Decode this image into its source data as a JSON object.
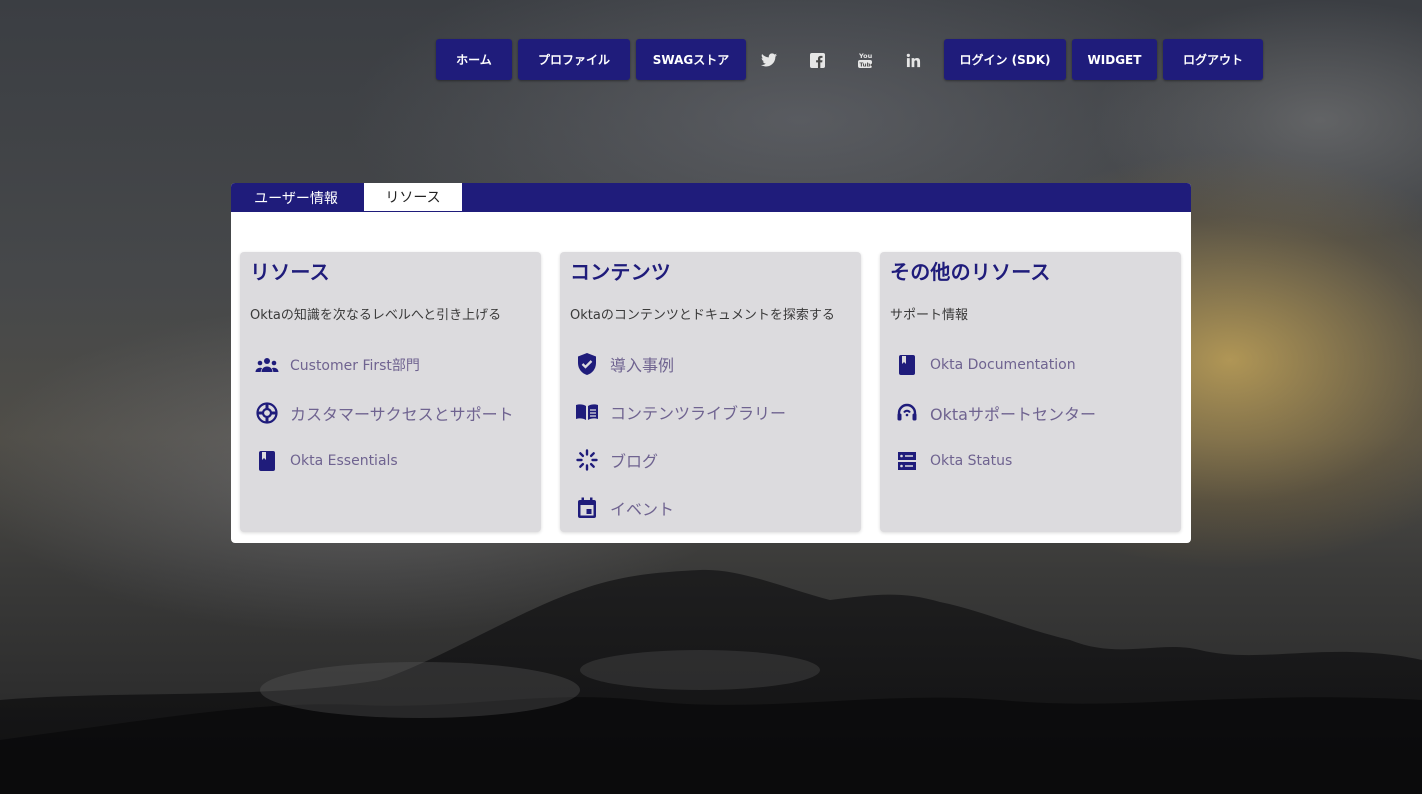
{
  "nav": {
    "home": "ホーム",
    "profile": "プロファイル",
    "swag_store": "SWAGストア",
    "login_sdk": "ログイン (SDK)",
    "widget": "WIDGET",
    "logout": "ログアウト",
    "social_icons": [
      "twitter-icon",
      "facebook-icon",
      "youtube-icon",
      "linkedin-icon"
    ]
  },
  "tabs": {
    "user_info": "ユーザー情報",
    "resources": "リソース",
    "active": "resources"
  },
  "cards": [
    {
      "title": "リソース",
      "subtitle": "Oktaの知識を次なるレベルへと引き上げる",
      "links": [
        {
          "label": "Customer First部門",
          "icon": "people-icon"
        },
        {
          "label": "カスタマーサクセスとサポート",
          "icon": "lifebuoy-icon"
        },
        {
          "label": "Okta Essentials",
          "icon": "book-icon"
        }
      ]
    },
    {
      "title": "コンテンツ",
      "subtitle": "Oktaのコンテンツとドキュメントを探索する",
      "links": [
        {
          "label": "導入事例",
          "icon": "shield-check-icon"
        },
        {
          "label": "コンテンツライブラリー",
          "icon": "open-book-icon"
        },
        {
          "label": "ブログ",
          "icon": "sparkle-icon"
        },
        {
          "label": "イベント",
          "icon": "calendar-icon"
        }
      ]
    },
    {
      "title": "その他のリソース",
      "subtitle": "サポート情報",
      "links": [
        {
          "label": "Okta Documentation",
          "icon": "book-icon"
        },
        {
          "label": "Oktaサポートセンター",
          "icon": "headset-icon"
        },
        {
          "label": "Okta Status",
          "icon": "server-icon"
        }
      ]
    }
  ],
  "colors": {
    "accent": "#1f1c7b",
    "card_bg": "#dcdbde",
    "link_text": "#6f6390"
  }
}
